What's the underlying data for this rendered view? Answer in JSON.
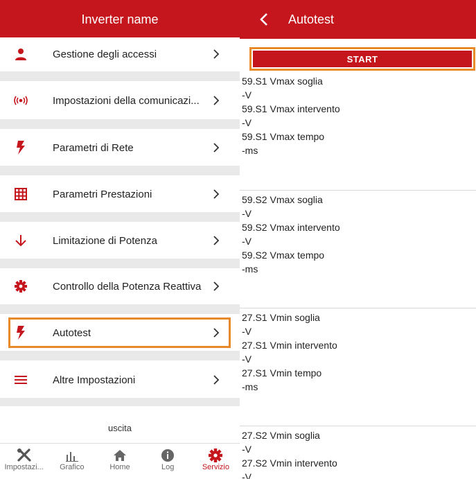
{
  "left": {
    "header_title": "Inverter name",
    "menu": [
      {
        "label": "Gestione degli accessi",
        "icon": "person-icon"
      },
      {
        "label": "Impostazioni della comunicazi...",
        "icon": "signal-icon"
      },
      {
        "label": "Parametri di Rete",
        "icon": "bolt-icon"
      },
      {
        "label": "Parametri Prestazioni",
        "icon": "grid-icon"
      },
      {
        "label": "Limitazione di Potenza",
        "icon": "arrow-down-icon"
      },
      {
        "label": "Controllo della Potenza Reattiva",
        "icon": "gear-icon"
      },
      {
        "label": "Autotest",
        "icon": "bolt-icon"
      },
      {
        "label": "Altre Impostazioni",
        "icon": "menu-icon"
      }
    ],
    "logout_label": "uscita",
    "tabs": [
      {
        "label": "Impostazi...",
        "icon": "tools-icon"
      },
      {
        "label": "Grafico",
        "icon": "chart-icon"
      },
      {
        "label": "Home",
        "icon": "home-icon"
      },
      {
        "label": "Log",
        "icon": "info-icon"
      },
      {
        "label": "Servizio",
        "icon": "gear-icon",
        "active": true
      }
    ]
  },
  "right": {
    "header_title": "Autotest",
    "start_label": "START",
    "groups": [
      [
        "59.S1 Vmax soglia",
        "-V",
        "59.S1 Vmax intervento",
        "-V",
        "59.S1 Vmax tempo",
        "-ms"
      ],
      [
        "59.S2 Vmax soglia",
        "-V",
        "59.S2 Vmax intervento",
        "-V",
        "59.S2 Vmax tempo",
        "-ms"
      ],
      [
        "27.S1 Vmin soglia",
        "-V",
        "27.S1 Vmin intervento",
        "-V",
        "27.S1 Vmin tempo",
        "-ms"
      ],
      [
        "27.S2 Vmin soglia",
        "-V",
        "27.S2 Vmin intervento",
        "-V"
      ]
    ]
  },
  "colors": {
    "brand_red": "#c4161c",
    "highlight_orange": "#e8892a"
  }
}
